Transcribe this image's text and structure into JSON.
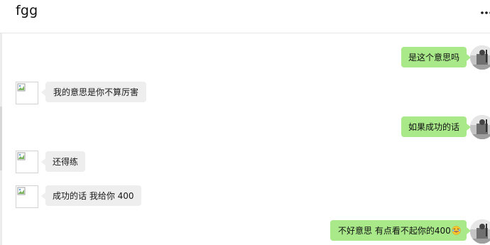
{
  "chat": {
    "title": "fgg",
    "more_icon": "more-horizontal-icon"
  },
  "messages": [
    {
      "sender": "self",
      "text": "是这个意思吗"
    },
    {
      "sender": "peer",
      "text": "我的意思是你不算厉害"
    },
    {
      "sender": "self",
      "text": "如果成功的话"
    },
    {
      "sender": "peer",
      "text": "还得练"
    },
    {
      "sender": "peer",
      "text": "成功的话 我给你 400"
    },
    {
      "sender": "self",
      "text": "不好意思 有点看不起你的400",
      "emoji": "laughing-emoji"
    }
  ],
  "colors": {
    "self_bubble": "#a9e98a",
    "peer_bubble": "#eeeeee",
    "background": "#ffffff"
  }
}
